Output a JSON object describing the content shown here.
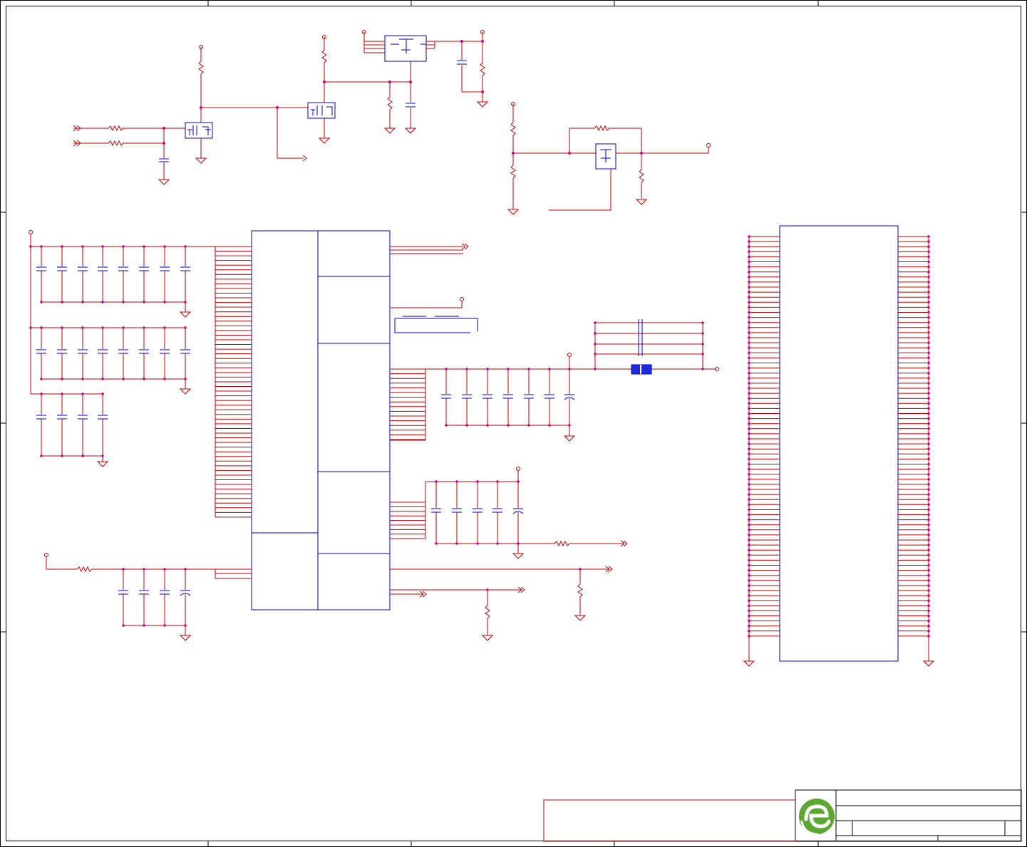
{
  "sheet": {
    "background": "#ffffff",
    "wire_color": "#c00000",
    "component_color": "#0000c8",
    "junction_color": "#c8008c",
    "border_color": "#000000"
  },
  "logo": {
    "icon": "green-e-logo-icon",
    "color": "#5aa832"
  }
}
